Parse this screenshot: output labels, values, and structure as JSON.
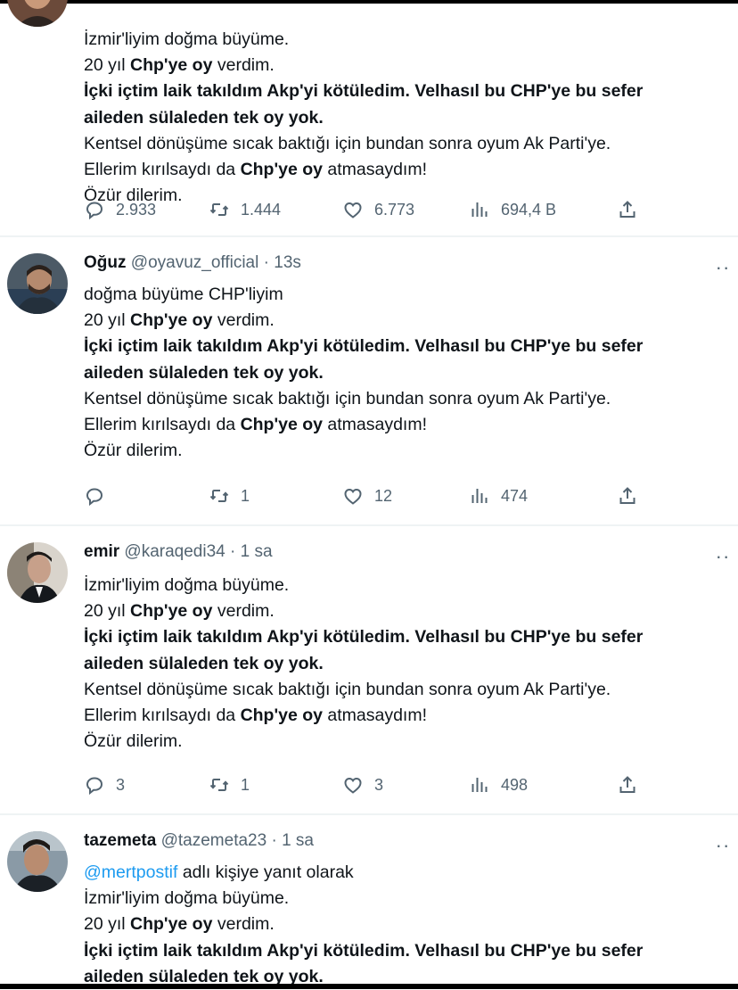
{
  "tweets": [
    {
      "show_header": false,
      "lines": [
        [
          {
            "t": "İzmir'liyim doğma büyüme."
          }
        ],
        [
          {
            "t": "20 yıl "
          },
          {
            "t": "Chp'ye oy",
            "b": true
          },
          {
            "t": " verdim."
          }
        ],
        [
          {
            "t": "İçki içtim laik takıldım Akp'yi kötüledim. Velhasıl bu CHP'ye bu sefer",
            "b": true
          }
        ],
        [
          {
            "t": "aileden sülaleden tek oy yok.",
            "b": true
          }
        ],
        [
          {
            "t": "Kentsel dönüşüme sıcak baktığı için bundan sonra oyum Ak Parti'ye."
          }
        ],
        [
          {
            "t": "Ellerim kırılsaydı da "
          },
          {
            "t": "Chp'ye oy",
            "b": true
          },
          {
            "t": " atmasaydım!"
          }
        ],
        [
          {
            "t": "Özür dilerim."
          }
        ]
      ],
      "stats": {
        "replies": "2.933",
        "retweets": "1.444",
        "likes": "6.773",
        "views": "694,4 B"
      }
    },
    {
      "show_header": true,
      "name": "Oğuz",
      "handle": "@oyavuz_official",
      "time": "13s",
      "lines": [
        [
          {
            "t": "doğma büyüme CHP'liyim"
          }
        ],
        [
          {
            "t": "20 yıl "
          },
          {
            "t": "Chp'ye oy",
            "b": true
          },
          {
            "t": " verdim."
          }
        ],
        [
          {
            "t": "İçki içtim laik takıldım Akp'yi kötüledim. Velhasıl bu CHP'ye bu sefer",
            "b": true
          }
        ],
        [
          {
            "t": "aileden sülaleden tek oy yok.",
            "b": true
          }
        ],
        [
          {
            "t": "Kentsel dönüşüme sıcak baktığı için bundan sonra oyum Ak Parti'ye."
          }
        ],
        [
          {
            "t": "Ellerim kırılsaydı da "
          },
          {
            "t": "Chp'ye oy",
            "b": true
          },
          {
            "t": " atmasaydım!"
          }
        ],
        [
          {
            "t": "Özür dilerim."
          }
        ]
      ],
      "stats": {
        "replies": "",
        "retweets": "1",
        "likes": "12",
        "views": "474"
      }
    },
    {
      "show_header": true,
      "name": "emir",
      "handle": "@karaqedi34",
      "time": "1 sa",
      "lines": [
        [
          {
            "t": "İzmir'liyim doğma büyüme."
          }
        ],
        [
          {
            "t": "20 yıl "
          },
          {
            "t": "Chp'ye oy",
            "b": true
          },
          {
            "t": " verdim."
          }
        ],
        [
          {
            "t": "İçki içtim laik takıldım Akp'yi kötüledim. Velhasıl bu CHP'ye bu sefer",
            "b": true
          }
        ],
        [
          {
            "t": "aileden sülaleden tek oy yok.",
            "b": true
          }
        ],
        [
          {
            "t": "Kentsel dönüşüme sıcak baktığı için bundan sonra oyum Ak Parti'ye."
          }
        ],
        [
          {
            "t": "Ellerim kırılsaydı da "
          },
          {
            "t": "Chp'ye oy",
            "b": true
          },
          {
            "t": " atmasaydım!"
          }
        ],
        [
          {
            "t": "Özür dilerim."
          }
        ]
      ],
      "stats": {
        "replies": "3",
        "retweets": "1",
        "likes": "3",
        "views": "498"
      }
    },
    {
      "show_header": true,
      "name": "tazemeta",
      "handle": "@tazemeta23",
      "time": "1 sa",
      "lines": [
        [
          {
            "t": "@mertpostif",
            "m": true
          },
          {
            "t": " adlı kişiye yanıt olarak"
          }
        ],
        [
          {
            "t": "İzmir'liyim doğma büyüme."
          }
        ],
        [
          {
            "t": "20 yıl "
          },
          {
            "t": "Chp'ye oy",
            "b": true
          },
          {
            "t": " verdim."
          }
        ],
        [
          {
            "t": "İçki içtim laik takıldım Akp'yi kötüledim. Velhasıl bu CHP'ye bu sefer",
            "b": true
          }
        ],
        [
          {
            "t": "aileden sülaleden tek oy yok.",
            "b": true
          }
        ]
      ]
    }
  ],
  "ui": {
    "dot": "·",
    "more_glyph": "··",
    "icons": [
      "reply-icon",
      "retweet-icon",
      "like-icon",
      "views-icon",
      "share-icon"
    ],
    "colors": {
      "text": "#0f1419",
      "secondary": "#536471",
      "separator": "#eff3f4",
      "link": "#1d9bf0"
    }
  }
}
